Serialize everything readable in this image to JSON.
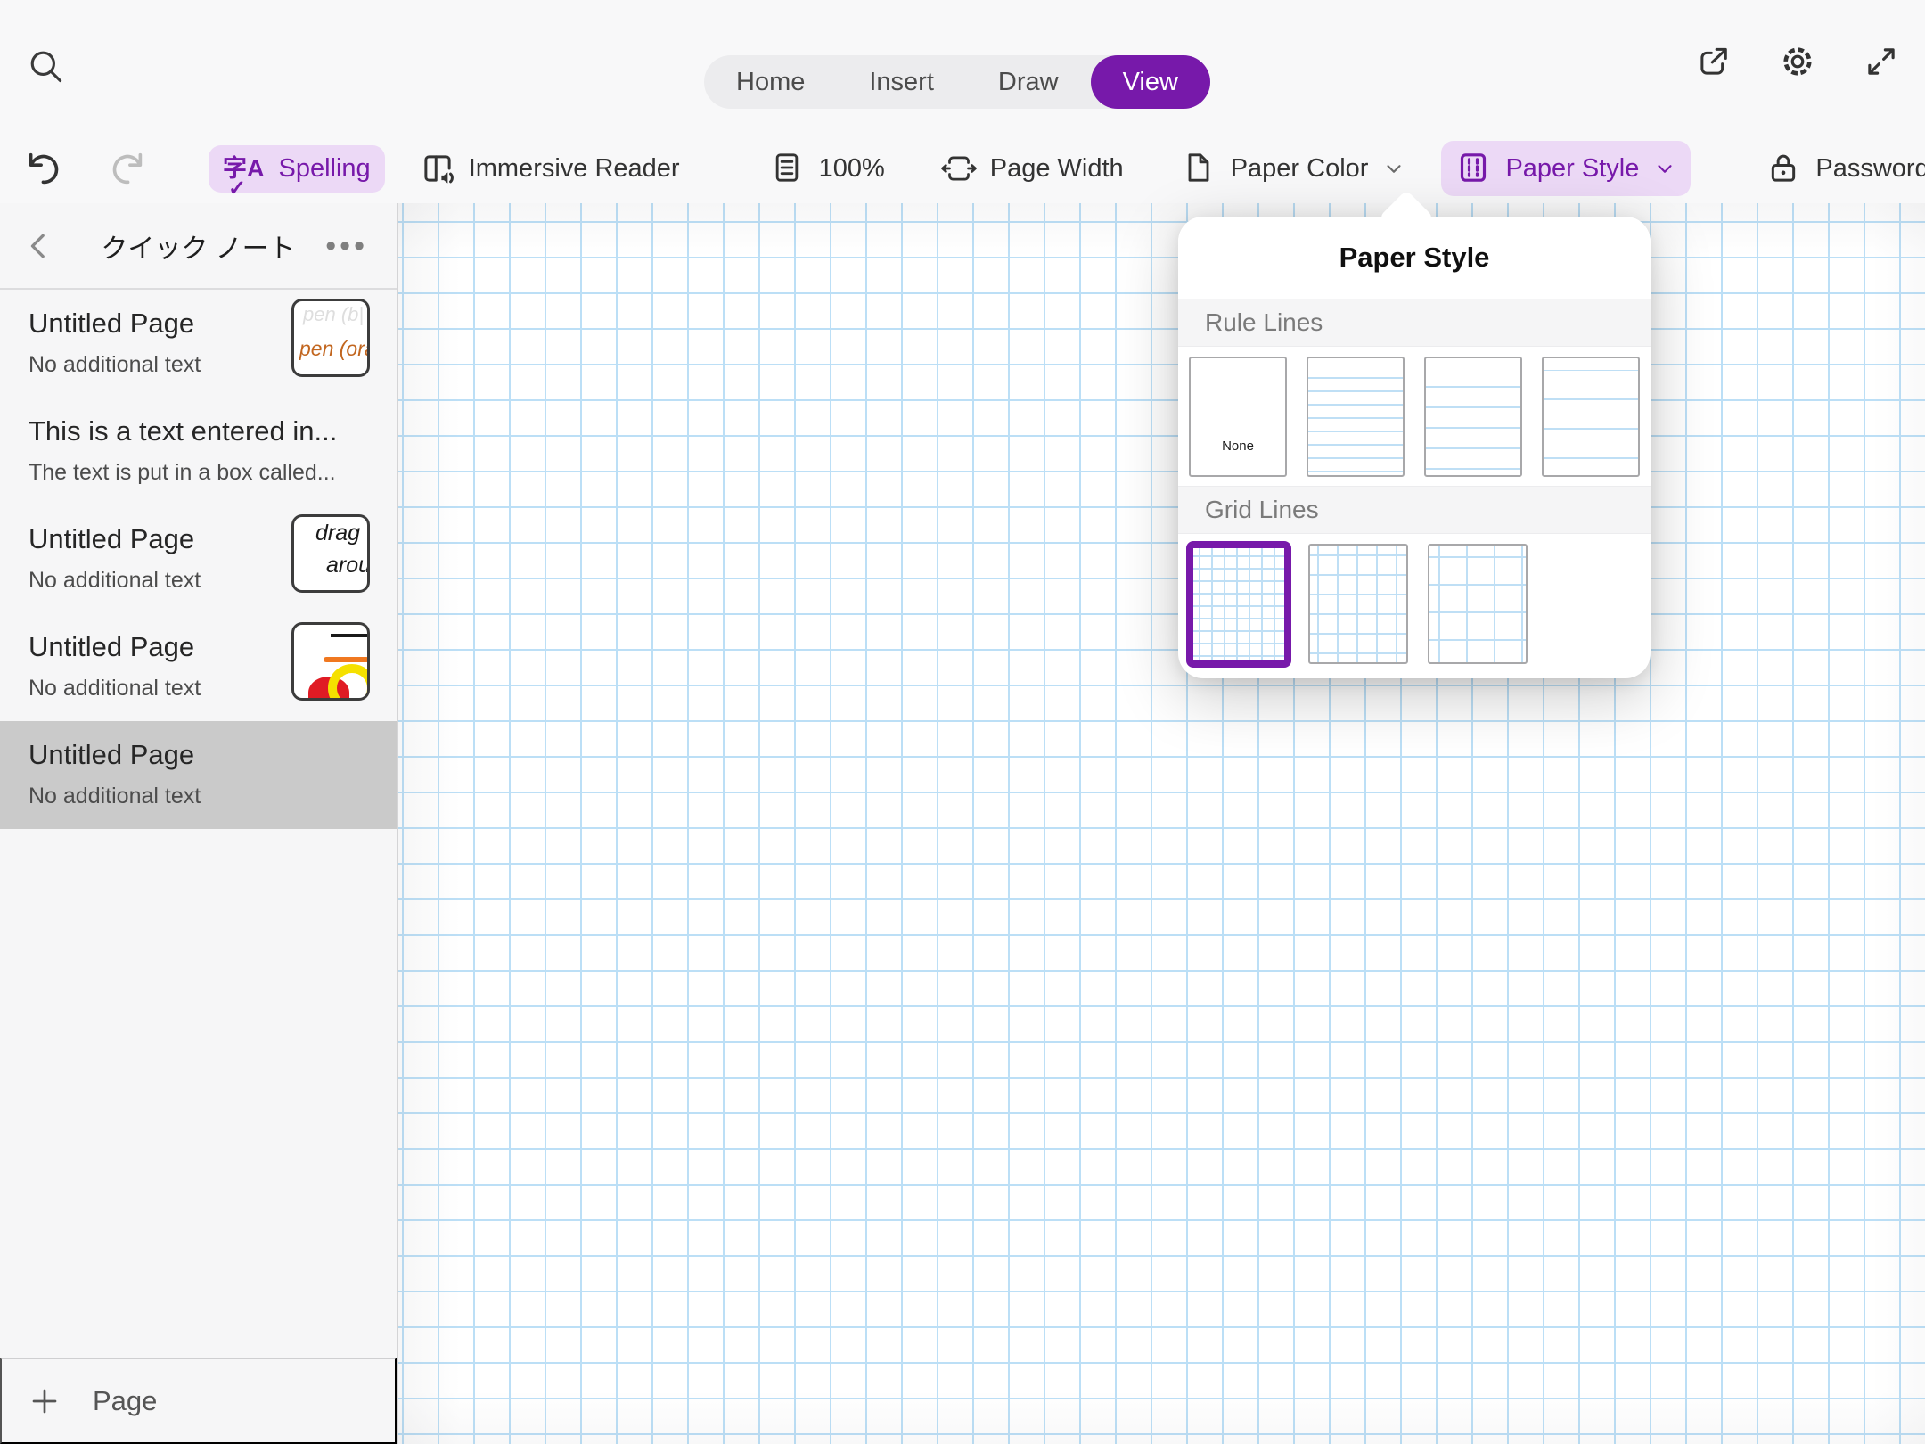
{
  "topbar": {
    "tabs": [
      {
        "label": "Home",
        "active": false
      },
      {
        "label": "Insert",
        "active": false
      },
      {
        "label": "Draw",
        "active": false
      },
      {
        "label": "View",
        "active": true
      }
    ],
    "tools": {
      "spelling_label": "Spelling",
      "immersive_reader_label": "Immersive Reader",
      "zoom_level": "100%",
      "page_width_label": "Page Width",
      "paper_color_label": "Paper Color",
      "paper_style_label": "Paper Style",
      "password_protection_label": "Password Protection"
    }
  },
  "sidebar": {
    "title": "クイック ノート",
    "add_page_label": "Page",
    "pages": [
      {
        "title": "Untitled Page",
        "subtitle": "No additional text",
        "thumbnail": {
          "faint_text": "pen (b|",
          "orange_text": "pen (ora"
        }
      },
      {
        "title": "This is a text entered in...",
        "subtitle": "The text is put in a box called..."
      },
      {
        "title": "Untitled Page",
        "subtitle": "No additional text",
        "thumbnail": {
          "ink_line1": "drag",
          "ink_line2": "arou"
        }
      },
      {
        "title": "Untitled Page",
        "subtitle": "No additional text",
        "thumbnail": {
          "drawing": "black line, orange line, red blob, yellow ring"
        }
      },
      {
        "title": "Untitled Page",
        "subtitle": "No additional text",
        "selected": true
      }
    ]
  },
  "popover": {
    "title": "Paper Style",
    "rule_lines_label": "Rule Lines",
    "grid_lines_label": "Grid Lines",
    "none_label": "None",
    "rule_options": [
      "none",
      "narrow",
      "medium",
      "wide"
    ],
    "grid_options": [
      "small",
      "medium",
      "large"
    ],
    "selected_option": "grid-small"
  },
  "icons": {
    "search-icon": "magnifying glass",
    "share-icon": "square with arrow",
    "settings-gear-icon": "gear",
    "expand-icon": "diagonal resize arrows",
    "undo-icon": "curved arrow left",
    "redo-icon": "curved arrow right (disabled)",
    "spelling-icon": "字A with checkmark",
    "immersive-reader-icon": "book with speaker",
    "zoom-page-icon": "page with lines",
    "page-width-icon": "page with left/right arrows",
    "paper-color-icon": "page with folded corner",
    "paper-style-icon": "page with dashed columns",
    "lock-icon": "padlock",
    "chevron-left-icon": "back chevron",
    "chevron-down-icon": "dropdown chevron",
    "ellipsis-icon": "three dots",
    "plus-icon": "plus sign"
  },
  "colors": {
    "accent": "#7719AA",
    "accent_light": "#ECD9F6",
    "canvas_grid_blue": "#BCDFF6",
    "swatch_line_blue": "#BFDFF5",
    "selected_row_gray": "#CACACA",
    "chrome_gray": "#F8F8F9"
  }
}
